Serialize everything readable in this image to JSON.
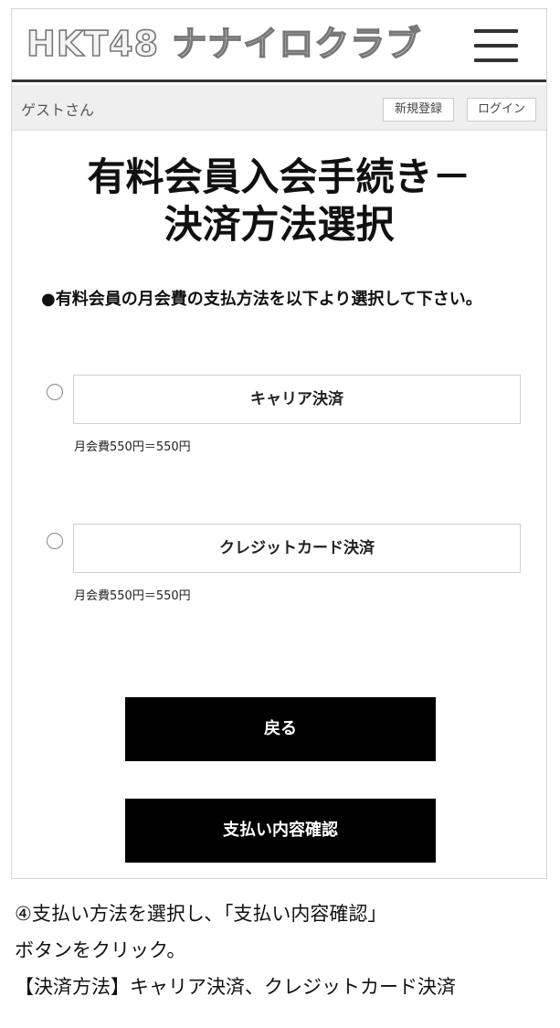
{
  "header": {
    "logo_text": "HKT48 ナナイロクラブ"
  },
  "guestbar": {
    "guest_name": "ゲストさん",
    "register_label": "新規登録",
    "login_label": "ログイン"
  },
  "main": {
    "title_line1": "有料会員入会手続き－",
    "title_line2": "決済方法選択",
    "instruction": "●有料会員の月会費の支払方法を以下より選択して下さい。",
    "options": [
      {
        "label": "キャリア決済",
        "fee": "月会費550円＝550円",
        "selected": false
      },
      {
        "label": "クレジットカード決済",
        "fee": "月会費550円＝550円",
        "selected": false
      }
    ],
    "back_label": "戻る",
    "confirm_label": "支払い内容確認"
  },
  "caption": {
    "line1": "④支払い方法を選択し､「支払い内容確認」",
    "line2": "ボタンをクリック。",
    "line3": "【決済方法】キャリア決済、クレジットカード決済"
  }
}
